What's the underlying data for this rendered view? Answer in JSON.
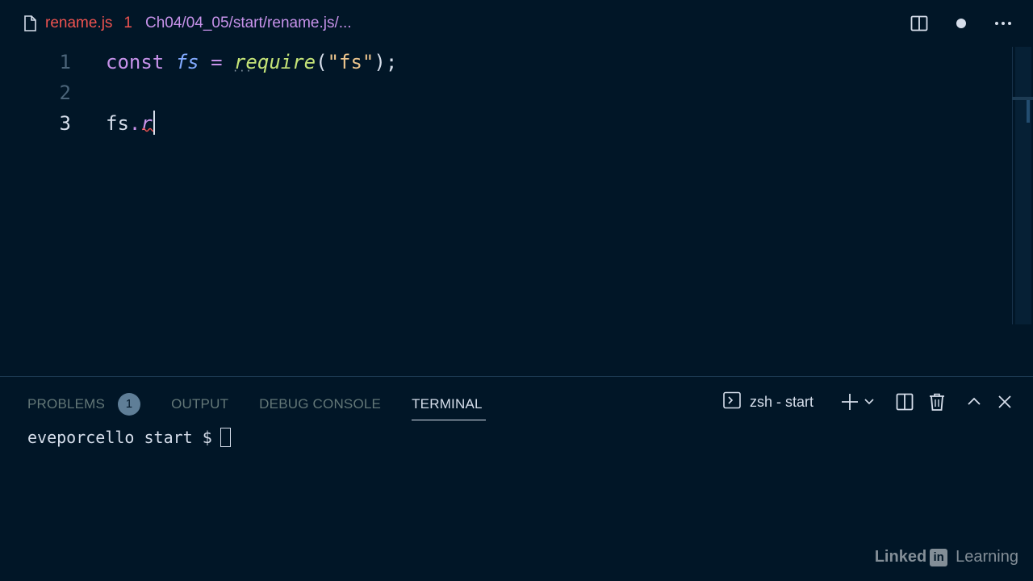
{
  "tab": {
    "filename": "rename.js",
    "error_count": "1",
    "path": "Ch04/04_05/start/rename.js/..."
  },
  "editor": {
    "line_numbers": [
      "1",
      "2",
      "3"
    ],
    "line1": {
      "keyword": "const",
      "variable": "fs",
      "operator": "=",
      "function": "require",
      "open_paren": "(",
      "string": "\"fs\"",
      "close": ");"
    },
    "line3": {
      "object": "fs",
      "dot": ".",
      "typed": "r"
    }
  },
  "panel": {
    "tabs": {
      "problems": "PROBLEMS",
      "problems_count": "1",
      "output": "OUTPUT",
      "debug_console": "DEBUG CONSOLE",
      "terminal": "TERMINAL"
    },
    "terminal_selector": "zsh - start",
    "prompt": "eveporcello start $"
  },
  "watermark": {
    "linked": "Linked",
    "in": "in",
    "learning": "Learning"
  },
  "icons": {
    "file": "file-icon",
    "split_editor": "split-editor-icon",
    "unsaved_dot": "unsaved-dot-icon",
    "more": "more-actions-icon",
    "terminal": "terminal-icon",
    "new_terminal": "plus-icon",
    "dropdown": "chevron-down-icon",
    "split_terminal": "split-terminal-icon",
    "kill_terminal": "trash-icon",
    "maximize": "chevron-up-icon",
    "close": "close-icon"
  },
  "colors": {
    "background": "#011627",
    "error": "#ef5350",
    "keyword": "#c792ea",
    "variable": "#82aaff",
    "function": "#c5e478",
    "string": "#ecc48d",
    "foreground": "#d6deeb"
  }
}
